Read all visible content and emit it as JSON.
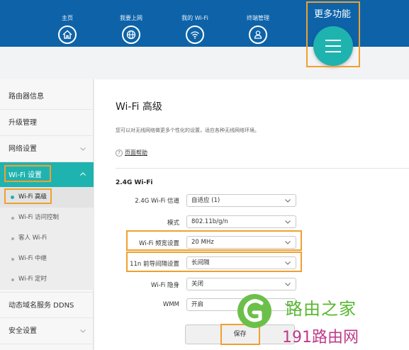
{
  "nav": {
    "items": [
      {
        "label": "主页",
        "icon": "home-icon"
      },
      {
        "label": "我要上网",
        "icon": "globe-icon"
      },
      {
        "label": "我的 Wi-Fi",
        "icon": "wifi-icon"
      },
      {
        "label": "终端管理",
        "icon": "user-icon"
      }
    ],
    "more": {
      "label": "更多功能",
      "icon": "menu-icon"
    }
  },
  "sidebar": {
    "items": [
      {
        "label": "路由器信息"
      },
      {
        "label": "升级管理"
      },
      {
        "label": "网络设置"
      },
      {
        "label": "Wi-Fi 设置"
      },
      {
        "label": "动态域名服务 DDNS"
      },
      {
        "label": "安全设置"
      }
    ],
    "wifi_subitems": [
      {
        "label": "Wi-Fi 高级"
      },
      {
        "label": "Wi-Fi 访问控制"
      },
      {
        "label": "客人 Wi-Fi"
      },
      {
        "label": "Wi-Fi 中继"
      },
      {
        "label": "Wi-Fi 定时"
      }
    ]
  },
  "content": {
    "title": "Wi-Fi 高级",
    "description": "您可以对无线网络做更多个性化的设置，适应各种无线网络环境。",
    "help_link": "页面帮助",
    "help_icon": "?",
    "section_title": "2.4G Wi-Fi",
    "rows": [
      {
        "label": "2.4G Wi-Fi 信道",
        "value": "自适应 (1)"
      },
      {
        "label": "模式",
        "value": "802.11b/g/n"
      },
      {
        "label": "Wi-Fi 频宽设置",
        "value": "20 MHz"
      },
      {
        "label": "11n 前导间隔设置",
        "value": "长间隔"
      },
      {
        "label": "Wi-Fi 隐身",
        "value": "关闭"
      },
      {
        "label": "WMM",
        "value": "开启"
      }
    ],
    "save_label": "保存"
  },
  "watermark": {
    "line1": "路由之家",
    "line2": "191路由网"
  },
  "colors": {
    "topbar": "#0e63a8",
    "accent_teal": "#1fb3b0",
    "highlight": "#f0a030",
    "watermark_green": "#58b830",
    "watermark_pink": "#c03a8a"
  }
}
